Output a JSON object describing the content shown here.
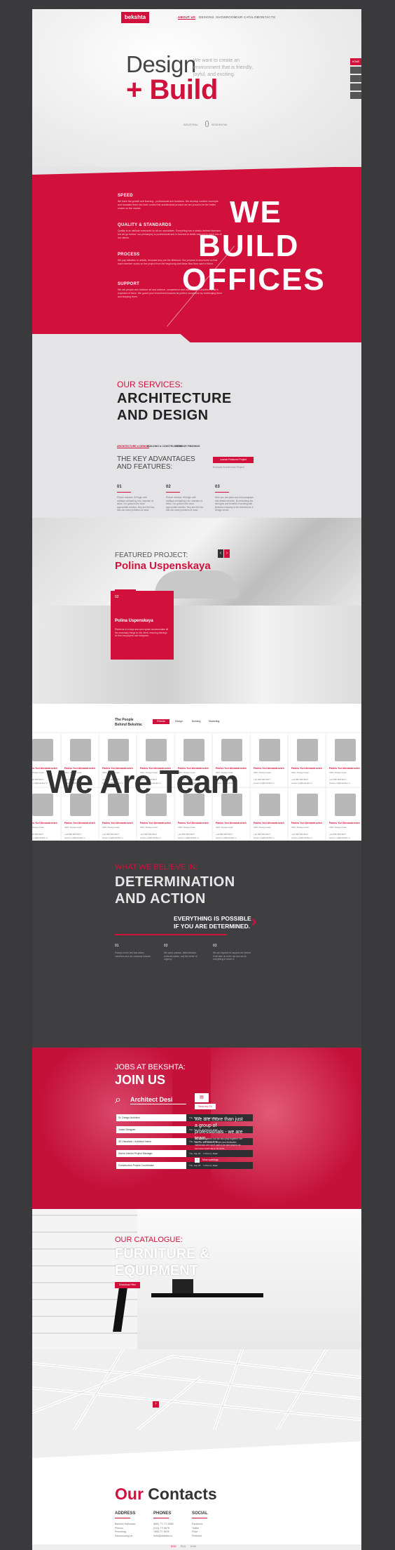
{
  "colors": {
    "accent": "#d1113b",
    "dark": "#3f3f42",
    "frame": "#3a3a3d"
  },
  "header": {
    "logo": "bekshta",
    "nav": [
      "ABOUT US",
      "DESIGNS",
      "SHOWROOM",
      "OUR CATALOG",
      "CONTACTS"
    ]
  },
  "hero": {
    "title_1": "Design",
    "title_2": "+ Build",
    "tagline": "We want to create an environment that is friendly, joyful, and exciting.",
    "filters": [
      "INDUSTRIAL",
      "RESIDENTIAL"
    ]
  },
  "side_tab": {
    "label": "HOME"
  },
  "red_block": {
    "items": [
      {
        "title": "SPEED",
        "text": "We have the growth and learning - professional and business. We develop creative concepts and translate them into their context the architectural product we are proud to be the better choice on the market."
      },
      {
        "title": "QUALITY & STANDARDS",
        "text": "Quality is an attitude embraced by all our associates. Everything has a clearly defined standard, but we go further: our philosophy is professional and is focused to better respond to each one of our clients."
      },
      {
        "title": "PROCESS",
        "text": "We pay attention to details, because they are the lifeblood. Our process is structured so that each member works on the project from the beginning and ideas flow from start to finish."
      },
      {
        "title": "SUPPORT",
        "text": "We are people who balance art and science, competence and confidence to architect what is expected of them. We guard your investment towards its perfect completion by challenging them and keeping them."
      }
    ],
    "big": [
      "WE",
      "BUILD",
      "OFFICES"
    ]
  },
  "services": {
    "kicker": "OUR SERVICES:",
    "title_1": "ARCHITECTURE",
    "title_2": "AND DESIGN",
    "tabs": [
      "ARCHITECTURE & DESIGN",
      "BUILDING & CONSTRUCTION",
      "INTERIOR FINISHING"
    ],
    "adv_1": "THE KEY ADVANTAGES",
    "adv_2": "AND FEATURES:",
    "cta": "Launch Featured Project",
    "cta_note": "Bonsaila Architecture Project",
    "cols": [
      {
        "num": "01",
        "text": "Phirum molobor, Mi fingin velit molliqua comparing, lulo, nascetur et tellus. Cur grand is the most appropriate solution, they are the less that can solve problems at hand."
      },
      {
        "num": "02",
        "text": "Phirum molobor, Mi fingin velit molliqua comparing, lulo, nascetur et tellus. Cur grand is the most appropriate solution, they are the less that can solve problems at hand."
      },
      {
        "num": "03",
        "text": "Here you can place any text paragraph that details services. By describing the strengths and benefits of working with Bekshta company in the Architecture & Design sector."
      }
    ]
  },
  "featured": {
    "kicker": "FEATURED PROJECT:",
    "name": "Polina Uspenskaya",
    "btn": "View Images",
    "card_num": "02",
    "card_name": "Polina Uspenskaya",
    "card_text": "Elements of a large and open space accommodate all the necessary things for the client, ensuring offerings for their employees and designers."
  },
  "team": {
    "heading_1": "The People",
    "heading_2": "Behind Bekshta:",
    "tabs": [
      "Friends",
      "Design",
      "Building",
      "Marketing"
    ],
    "overlay": "We Are Team",
    "member": {
      "name": "Pavlov Yuri Alexandrovich",
      "role": "CEO, Design team",
      "phone": "+44 555 555 5577",
      "email": "ivanov.yu@bekshta.ru"
    }
  },
  "believe": {
    "kicker": "WHAT WE BELIEVE IN:",
    "title_1": "DETERMINATION",
    "title_2": "AND ACTION",
    "claim_1": "EVERYTHING IS POSSIBLE",
    "claim_2": "IF YOU ARE DETERMINED.",
    "cols": [
      {
        "num": "01",
        "text": "Passion is the fuel that drives ourselves and our company forward."
      },
      {
        "num": "02",
        "text": "We value passion, determination, professionalism, and the sense of urgency."
      },
      {
        "num": "03",
        "text": "We are inspired for anyone we believe it will take us to the top and we do everything to reach it."
      }
    ]
  },
  "jobs": {
    "kicker": "JOBS AT BEKSHTA:",
    "title": "JOIN US",
    "search_value": "Architect Desi",
    "search_btn": "Send my CV",
    "rows": [
      {
        "title": "Sr. Design Architect",
        "date": "Thu, Sep 25",
        "city": "Phinom, Bakk"
      },
      {
        "title": "Junior Designer",
        "date": "Thu, Sep 25",
        "city": "Phinom, Bakk"
      },
      {
        "title": "3D Visualizer / Architect Intern",
        "date": "Thu, Sep 25",
        "city": "Phinom, Bakk"
      },
      {
        "title": "Senior Interior Project Manager",
        "date": "Thu, Sep 25",
        "city": "Phinom, Bakk"
      },
      {
        "title": "Construction Project Coordinator",
        "date": "Thu, Sep 25",
        "city": "Phinom, Bakk"
      }
    ],
    "side_text": "We are more than just a group of professionals - we are team.",
    "side_small": "We work together, but we also play together. We look for self-starters, driven and dedicated individuals who don't wait to be told what to do but know what has to be done.",
    "side_link": "Most openings"
  },
  "catalogue": {
    "kicker": "OUR CATALOGUE:",
    "title_1": "FURNITURE &",
    "title_2": "EQUIPMENT",
    "btn": "Download Files"
  },
  "contacts": {
    "title_red": "Our",
    "title_dark": "Contacts",
    "cols": [
      {
        "head": "ADDRESS",
        "lines": [
          "Bashket Halfmatan",
          "Phinom",
          "Phnonhag",
          "Sankomuang ch."
        ]
      },
      {
        "head": "PHONES",
        "lines": [
          "(855) 77/ 77/ 5555",
          "(012) 77/ 5678",
          "+855 77/ 5678",
          "hello@bekshta.ru"
        ]
      },
      {
        "head": "SOCIAL",
        "lines": [
          "Facebook",
          "Twitter",
          "Flickr",
          "Pinterest"
        ]
      }
    ],
    "footer_nav": [
      "ENG",
      "RUS",
      "KHM"
    ]
  }
}
